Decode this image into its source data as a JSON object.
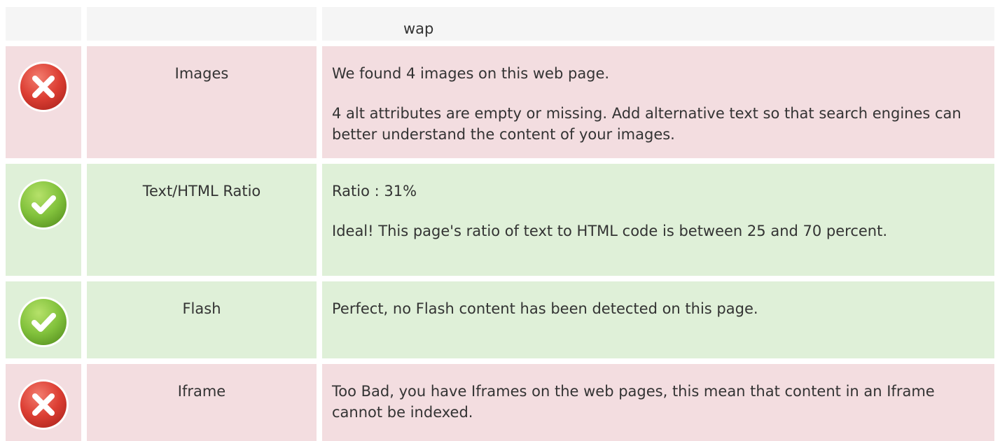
{
  "header": {
    "label": "",
    "value": "wap"
  },
  "rows": [
    {
      "status": "bad",
      "icon": "error-x-icon",
      "label": "Images",
      "paragraphs": [
        "We found 4 images on this web page.",
        "4 alt attributes are empty or missing. Add alternative text so that search engines can better understand the content of your images."
      ]
    },
    {
      "status": "good",
      "icon": "success-check-icon",
      "label": "Text/HTML Ratio",
      "paragraphs": [
        "Ratio : 31%",
        "Ideal! This page's ratio of text to HTML code is between 25 and 70 percent."
      ]
    },
    {
      "status": "good",
      "icon": "success-check-icon",
      "label": "Flash",
      "paragraphs": [
        "Perfect, no Flash content has been detected on this page."
      ]
    },
    {
      "status": "bad",
      "icon": "error-x-icon",
      "label": "Iframe",
      "paragraphs": [
        "Too Bad, you have Iframes on the web pages, this mean that content in an Iframe cannot be indexed."
      ]
    }
  ],
  "colors": {
    "bad_row": "#f3dde0",
    "good_row": "#dff0d8",
    "neutral_row": "#f5f5f5",
    "error_icon": "#d9403a",
    "success_icon": "#7fbf3a"
  }
}
